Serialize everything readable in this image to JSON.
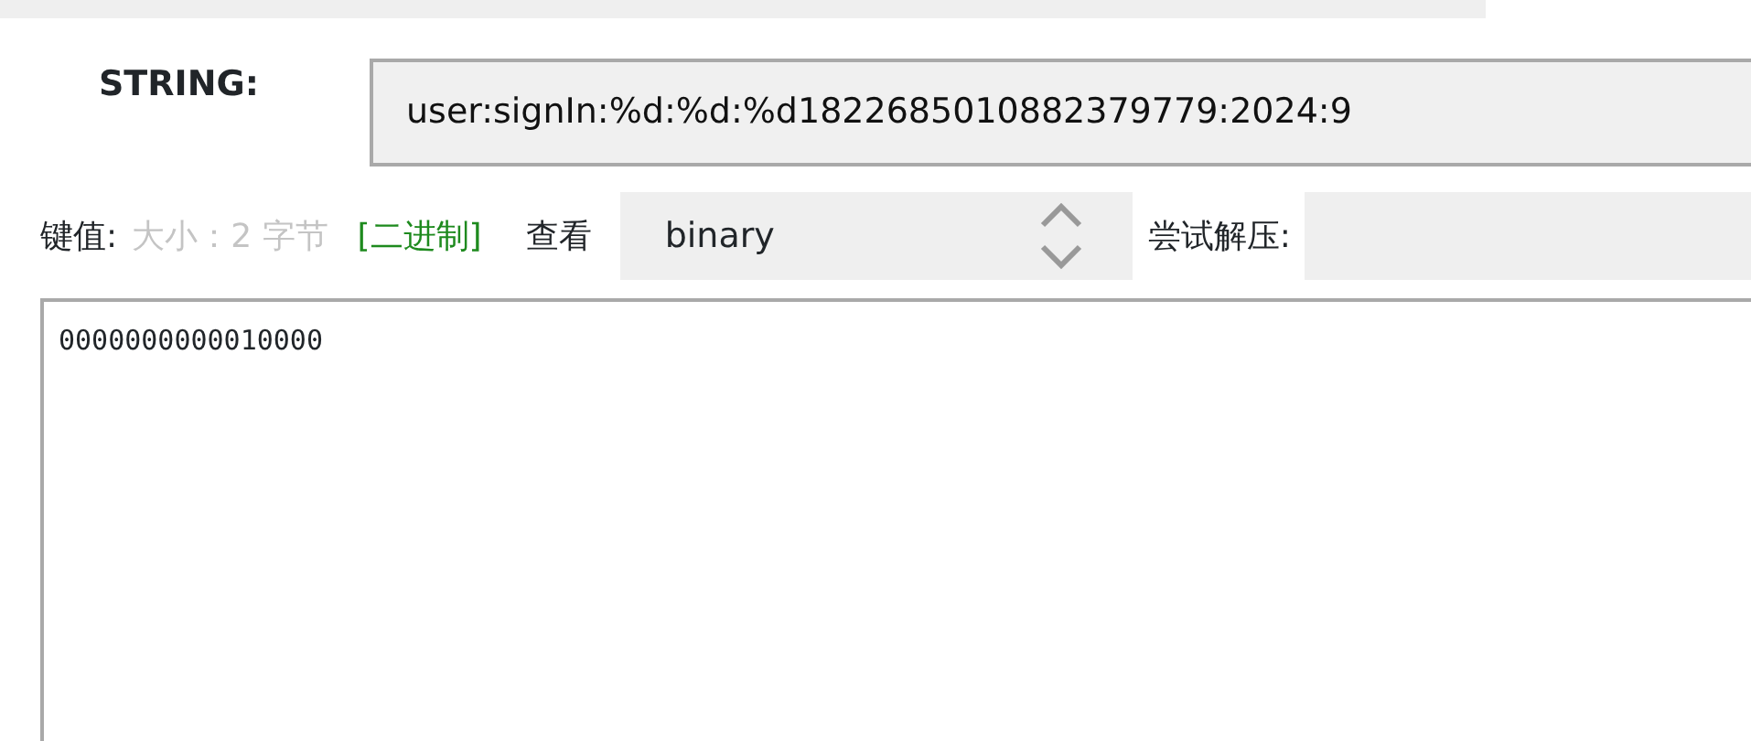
{
  "key_field": {
    "label": "STRING:",
    "value": "user:signIn:%d:%d:%d1822685010882379779:2024:9"
  },
  "value_bar": {
    "label": "键值:",
    "size": "大小：2 字节",
    "format_tag": "[二进制]",
    "view_label": "查看",
    "view_select": "binary",
    "decompress_label": "尝试解压:"
  },
  "value_text": "0000000000010000"
}
